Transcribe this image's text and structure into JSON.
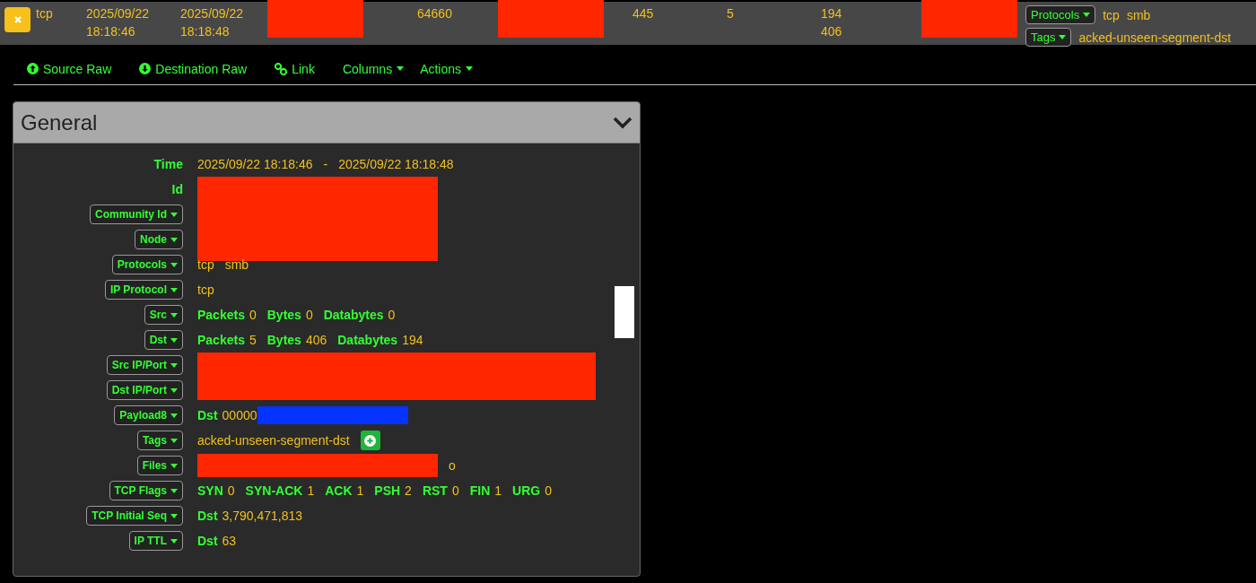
{
  "session_row": {
    "cells": [
      {
        "kind": "text",
        "lines": [
          "tcp"
        ]
      },
      {
        "kind": "text",
        "lines": [
          "2025/09/22",
          "18:18:46"
        ]
      },
      {
        "kind": "text",
        "lines": [
          "2025/09/22",
          "18:18:48"
        ]
      },
      {
        "kind": "redaction",
        "color": "#ff2600"
      },
      {
        "kind": "text",
        "lines": [
          "64660"
        ]
      },
      {
        "kind": "redaction",
        "color": "#ff2600"
      },
      {
        "kind": "text",
        "lines": [
          "445"
        ]
      },
      {
        "kind": "text",
        "lines": [
          "5"
        ]
      },
      {
        "kind": "text",
        "lines": [
          "194",
          "406"
        ]
      },
      {
        "kind": "redaction",
        "color": "#ff2600"
      }
    ],
    "fields": [
      {
        "label": "Protocols",
        "values": [
          "tcp",
          "smb"
        ]
      },
      {
        "label": "Tags",
        "values": [
          "acked-unseen-segment-dst"
        ]
      }
    ]
  },
  "nav": [
    {
      "label": "Source Raw",
      "kind": "upload"
    },
    {
      "label": "Destination Raw",
      "kind": "download"
    },
    {
      "label": "Link",
      "kind": "link"
    },
    {
      "label": "Columns",
      "kind": "menu"
    },
    {
      "label": "Actions",
      "kind": "menu"
    }
  ],
  "panel": {
    "title": "General",
    "expanded": true,
    "rows": [
      {
        "label": "Time",
        "kind": "text",
        "parts": [
          {
            "kind": "val",
            "text": "2025/09/22 18:18:46"
          },
          {
            "kind": "val",
            "text": "-"
          },
          {
            "kind": "val",
            "text": "2025/09/22 18:18:48"
          }
        ]
      },
      {
        "label": "Id",
        "kind": "text",
        "parts": [
          {
            "kind": "redaction",
            "color": "#ff2600"
          }
        ]
      },
      {
        "label": "Community Id",
        "kind": "menu",
        "parts": []
      },
      {
        "label": "Node",
        "kind": "menu",
        "parts": []
      },
      {
        "label": "Protocols",
        "kind": "menu",
        "parts": [
          {
            "kind": "val",
            "text": "tcp"
          },
          {
            "kind": "val",
            "text": "smb"
          }
        ]
      },
      {
        "label": "IP Protocol",
        "kind": "menu",
        "parts": [
          {
            "kind": "val",
            "text": "tcp"
          }
        ]
      },
      {
        "label": "Src",
        "kind": "menu",
        "parts": [
          {
            "kind": "key",
            "text": "Packets"
          },
          {
            "kind": "val",
            "text": "0"
          },
          {
            "kind": "key",
            "text": "Bytes"
          },
          {
            "kind": "val",
            "text": "0"
          },
          {
            "kind": "key",
            "text": "Databytes"
          },
          {
            "kind": "val",
            "text": "0"
          }
        ]
      },
      {
        "label": "Dst",
        "kind": "menu",
        "parts": [
          {
            "kind": "key",
            "text": "Packets"
          },
          {
            "kind": "val",
            "text": "5"
          },
          {
            "kind": "key",
            "text": "Bytes"
          },
          {
            "kind": "val",
            "text": "406"
          },
          {
            "kind": "key",
            "text": "Databytes"
          },
          {
            "kind": "val",
            "text": "194"
          }
        ]
      },
      {
        "label": "Src IP/Port",
        "kind": "menu",
        "parts": [
          {
            "kind": "redaction",
            "color": "#ff2600"
          }
        ]
      },
      {
        "label": "Dst IP/Port",
        "kind": "menu",
        "parts": []
      },
      {
        "label": "Payload8",
        "kind": "menu",
        "parts": [
          {
            "kind": "key",
            "text": "Dst"
          },
          {
            "kind": "val",
            "text": "00000"
          },
          {
            "kind": "redaction",
            "color": "#0433ff"
          }
        ]
      },
      {
        "label": "Tags",
        "kind": "menu",
        "parts": [
          {
            "kind": "val",
            "text": "acked-unseen-segment-dst"
          },
          {
            "kind": "add"
          }
        ]
      },
      {
        "label": "Files",
        "kind": "menu",
        "parts": [
          {
            "kind": "redaction",
            "color": "#ff2600"
          },
          {
            "kind": "val",
            "text": "o"
          }
        ]
      },
      {
        "label": "TCP Flags",
        "kind": "menu",
        "parts": [
          {
            "kind": "key",
            "text": "SYN"
          },
          {
            "kind": "val",
            "text": "0"
          },
          {
            "kind": "key",
            "text": "SYN-ACK"
          },
          {
            "kind": "val",
            "text": "1"
          },
          {
            "kind": "key",
            "text": "ACK"
          },
          {
            "kind": "val",
            "text": "1"
          },
          {
            "kind": "key",
            "text": "PSH"
          },
          {
            "kind": "val",
            "text": "2"
          },
          {
            "kind": "key",
            "text": "RST"
          },
          {
            "kind": "val",
            "text": "0"
          },
          {
            "kind": "key",
            "text": "FIN"
          },
          {
            "kind": "val",
            "text": "1"
          },
          {
            "kind": "key",
            "text": "URG"
          },
          {
            "kind": "val",
            "text": "0"
          }
        ]
      },
      {
        "label": "TCP Initial Seq",
        "kind": "menu",
        "parts": [
          {
            "kind": "key",
            "text": "Dst"
          },
          {
            "kind": "val",
            "text": "3,790,471,813"
          }
        ]
      },
      {
        "label": "IP TTL",
        "kind": "menu",
        "parts": [
          {
            "kind": "key",
            "text": "Dst"
          },
          {
            "kind": "val",
            "text": "63"
          }
        ]
      }
    ]
  }
}
